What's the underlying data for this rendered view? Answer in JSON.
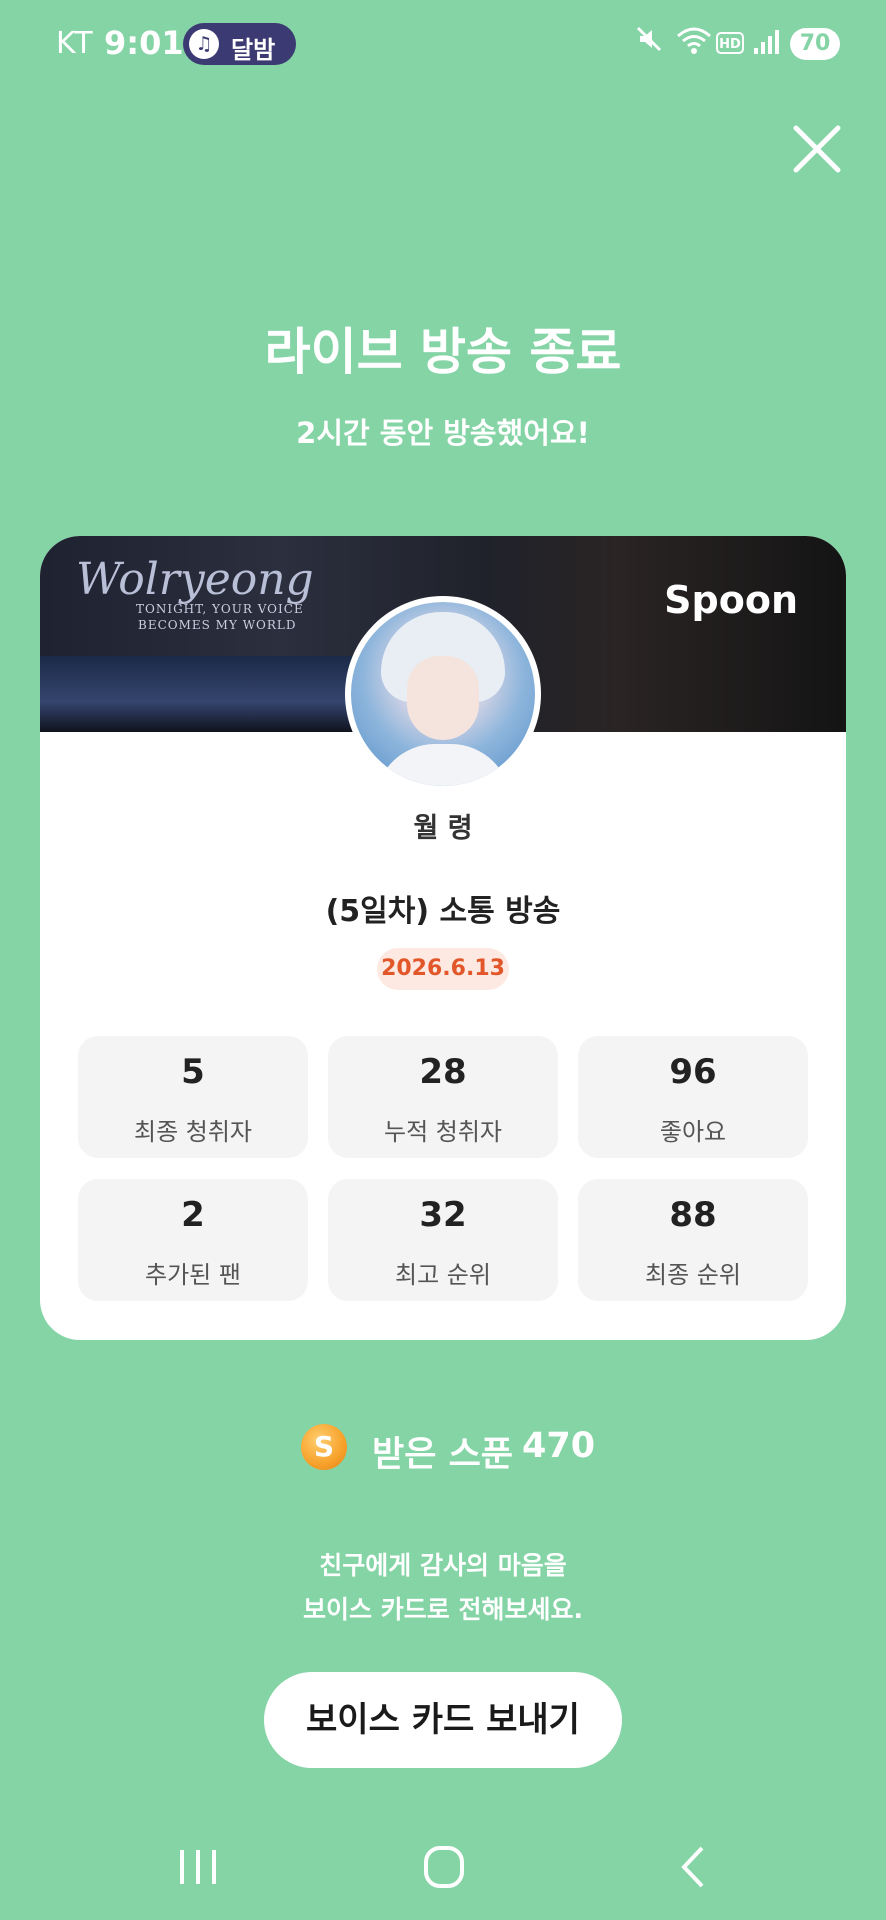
{
  "status_bar": {
    "carrier": "KT",
    "time": "9:01",
    "media_pill_label": "달밤",
    "hd_label": "HD",
    "battery": "70"
  },
  "header": {
    "title": "라이브 방송 종료",
    "subtitle": "2시간 동안 방송했어요!"
  },
  "card": {
    "banner": {
      "script_text": "Wolryeong",
      "tagline_line1": "TONIGHT, YOUR VOICE",
      "tagline_line2": "BECOMES MY WORLD",
      "brand": "Spoon"
    },
    "host_name": "월 령",
    "stream_title": "(5일차) 소통 방송",
    "date": "2026.6.13",
    "stats": [
      {
        "value": "5",
        "label": "최종 청취자"
      },
      {
        "value": "28",
        "label": "누적 청취자"
      },
      {
        "value": "96",
        "label": "좋아요"
      },
      {
        "value": "2",
        "label": "추가된 팬"
      },
      {
        "value": "32",
        "label": "최고 순위"
      },
      {
        "value": "88",
        "label": "최종 순위"
      }
    ]
  },
  "spoons": {
    "icon_letter": "S",
    "label": "받은 스푼",
    "count": "470"
  },
  "message": {
    "line1": "친구에게 감사의 마음을",
    "line2": "보이스 카드로 전해보세요."
  },
  "cta": {
    "label": "보이스 카드 보내기"
  },
  "colors": {
    "background": "#84d4a6",
    "date_badge_text": "#e2572a",
    "date_badge_bg": "#fde9e1"
  },
  "icons": [
    "music-note-icon",
    "mute-icon",
    "wifi-icon",
    "signal-icon",
    "close-icon",
    "spoon-coin-icon",
    "recent-apps-icon",
    "home-icon",
    "back-icon"
  ]
}
